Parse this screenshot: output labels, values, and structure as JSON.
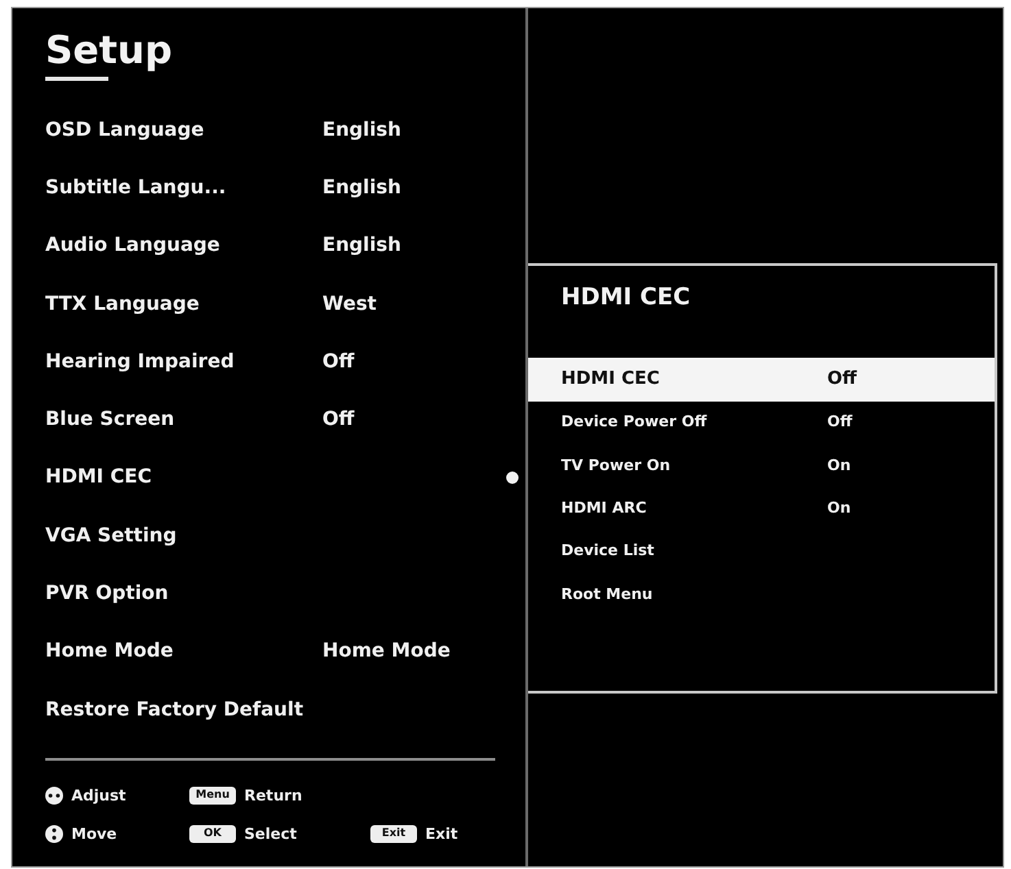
{
  "menu": {
    "title": "Setup",
    "items": [
      {
        "label": "OSD Language",
        "value": "English",
        "selected": false
      },
      {
        "label": "Subtitle Langu...",
        "value": "English",
        "selected": false
      },
      {
        "label": "Audio Language",
        "value": "English",
        "selected": false
      },
      {
        "label": "TTX Language",
        "value": "West",
        "selected": false
      },
      {
        "label": "Hearing Impaired",
        "value": "Off",
        "selected": false
      },
      {
        "label": "Blue Screen",
        "value": "Off",
        "selected": false
      },
      {
        "label": "HDMI CEC",
        "selected": true
      },
      {
        "label": "VGA Setting",
        "selected": false
      },
      {
        "label": "PVR Option",
        "selected": false
      },
      {
        "label": "Home Mode",
        "value": "Home Mode",
        "selected": false
      },
      {
        "label": "Restore Factory Default",
        "selected": false
      }
    ]
  },
  "footer": {
    "rows": [
      {
        "hints": [
          {
            "kind": "lr-pad",
            "label": "Adjust"
          },
          {
            "kind": "key",
            "key": "Menu",
            "label": "Return"
          }
        ]
      },
      {
        "hints": [
          {
            "kind": "ud-pad",
            "label": "Move"
          },
          {
            "kind": "key",
            "key": "OK",
            "label": "Select"
          },
          {
            "kind": "key",
            "key": "Exit",
            "label": "Exit"
          }
        ]
      }
    ]
  },
  "submenu": {
    "title": "HDMI CEC",
    "items": [
      {
        "label": "HDMI CEC",
        "value": "Off",
        "selected": true
      },
      {
        "label": "Device Power Off",
        "value": "Off",
        "selected": false
      },
      {
        "label": "TV Power On",
        "value": "On",
        "selected": false
      },
      {
        "label": "HDMI ARC",
        "value": "On",
        "selected": false
      },
      {
        "label": "Device List",
        "selected": false
      },
      {
        "label": "Root Menu",
        "selected": false
      }
    ]
  }
}
